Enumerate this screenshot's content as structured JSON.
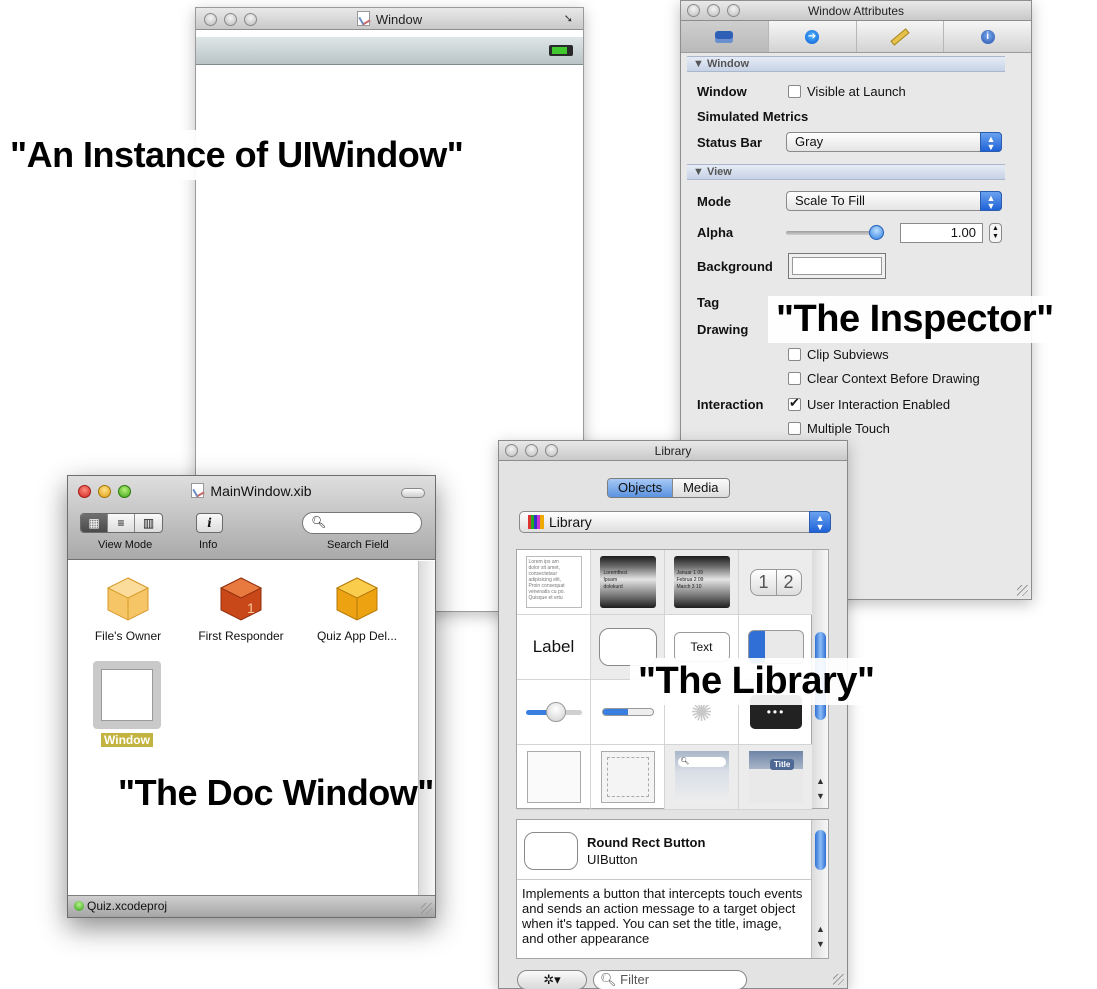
{
  "captions": {
    "uiwindow": "\"An Instance of UIWindow\"",
    "inspector": "\"The Inspector\"",
    "library": "\"The Library\"",
    "docwindow": "\"The Doc Window\""
  },
  "uiwindow": {
    "title": "Window",
    "icons": [
      "zoom-arrow-icon",
      "battery-icon"
    ]
  },
  "inspector": {
    "title": "Window Attributes",
    "tabs": [
      "attributes-tab-icon",
      "connections-tab-icon",
      "size-tab-icon",
      "identity-tab-icon"
    ],
    "window_section": "▼ Window",
    "window_label": "Window",
    "visible_at_launch": "Visible at Launch",
    "simulated_metrics": "Simulated Metrics",
    "status_bar_label": "Status Bar",
    "status_bar_value": "Gray",
    "view_section": "▼ View",
    "mode_label": "Mode",
    "mode_value": "Scale To Fill",
    "alpha_label": "Alpha",
    "alpha_value": "1.00",
    "alpha_fraction": 1.0,
    "background_label": "Background",
    "tag_label": "Tag",
    "drawing_label": "Drawing",
    "clip_subviews": "Clip Subviews",
    "clear_context": "Clear Context Before Drawing",
    "interaction_label": "Interaction",
    "user_interaction": "User Interaction Enabled",
    "user_interaction_checked": true,
    "multiple_touch": "Multiple Touch"
  },
  "docwindow": {
    "title": "MainWindow.xib",
    "view_mode_label": "View Mode",
    "info_label": "Info",
    "search_field_label": "Search Field",
    "info_glyph": "i",
    "objects": [
      {
        "label": "File's Owner",
        "icon": "files-owner-cube-icon",
        "color": "#f2b646"
      },
      {
        "label": "First Responder",
        "icon": "first-responder-cube-icon",
        "color": "#d2571f"
      },
      {
        "label": "Quiz App Del...",
        "icon": "app-delegate-cube-icon",
        "color": "#f0a70e"
      }
    ],
    "window_object": "Window",
    "status": "Quiz.xcodeproj"
  },
  "library": {
    "title": "Library",
    "tabs": [
      "Objects",
      "Media"
    ],
    "selected_tab": "Objects",
    "popup_value": "Library",
    "cells": {
      "label_text": "Label",
      "text_field_text": "Text",
      "segmented": [
        "1",
        "2"
      ],
      "bar_button_title": "Title",
      "textview_lines": [
        "Lorem ips am",
        "dolor sit amet,",
        "consectetaur",
        "adipisicing elit,",
        "Proin consequat",
        "venenatis cu po.",
        "Quisque et ertu"
      ],
      "picker_rows": [
        "Loremftest",
        "Ipsam",
        "dolokurd"
      ],
      "datepicker_rows": [
        [
          "Januar",
          "1",
          "09"
        ],
        [
          "Februa",
          "2",
          "09"
        ],
        [
          "March",
          "3",
          "10"
        ]
      ]
    },
    "detail": {
      "name": "Round Rect Button",
      "class": "UIButton",
      "description": "Implements a button that intercepts touch events and sends an action message to a target object when it's tapped. You can set the title, image, and other appearance"
    },
    "gear_label": "✲▾",
    "filter_placeholder": "Filter"
  }
}
